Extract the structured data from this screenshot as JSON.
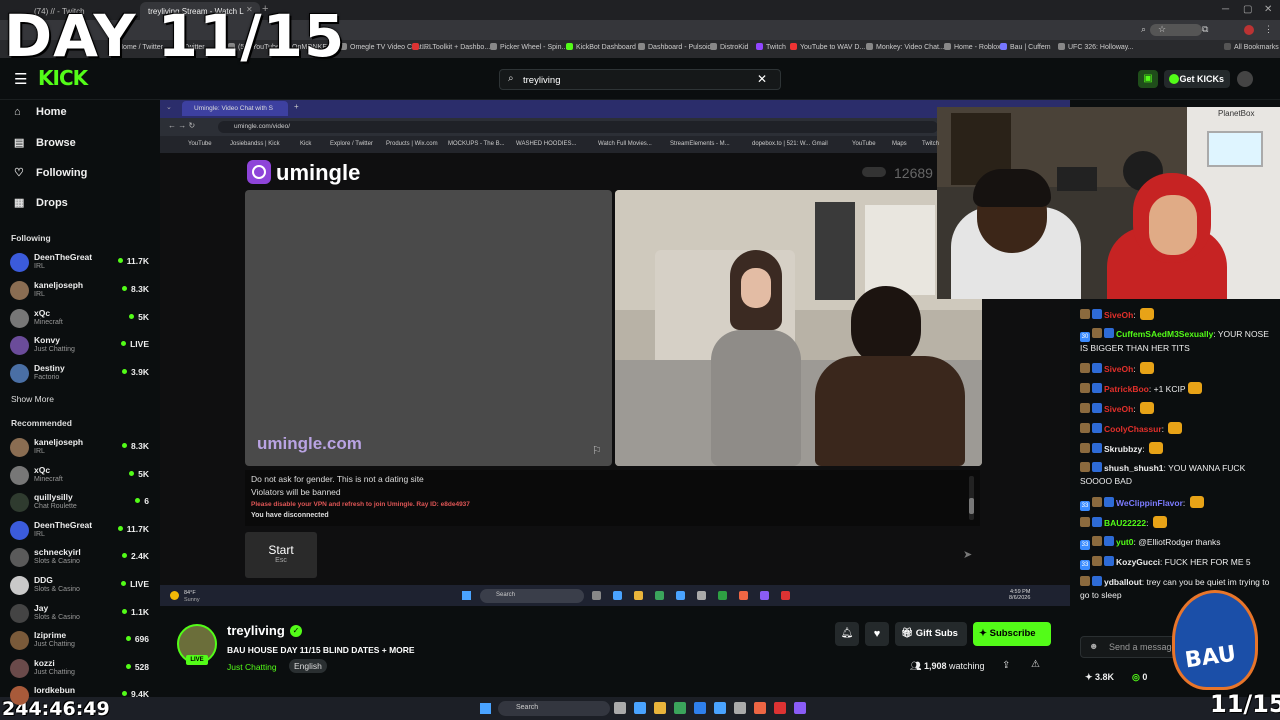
{
  "overlay": {
    "day": "DAY 11/15",
    "clock": "244:46:49",
    "day_corner": "11/15"
  },
  "browser": {
    "tabs": [
      {
        "label": "(74) // - Twitch"
      },
      {
        "label": "treyliving Stream - Watch L"
      }
    ],
    "bookmarks": [
      "Home / Twitter",
      "Twitter",
      "(57) YouTube",
      "OnMONKEY",
      "Omegle TV Video Chat...",
      "IRLToolkit + Dashbo...",
      "Picker Wheel - Spin...",
      "KickBot Dashboard",
      "Dashboard - Pulsoid",
      "DistroKid",
      "Twitch",
      "YouTube to WAV D...",
      "Monkey: Video Chat...",
      "Home - Roblox",
      "Bau | Cuffem",
      "UFC 326: Holloway..."
    ],
    "all_bookmarks": "All Bookmarks"
  },
  "kick": {
    "logo": "KICK",
    "search_value": "treyliving",
    "get_kicks": "Get KICKs",
    "nav": [
      {
        "label": "Home",
        "icon": "home-icon"
      },
      {
        "label": "Browse",
        "icon": "browse-icon"
      },
      {
        "label": "Following",
        "icon": "heart-icon"
      },
      {
        "label": "Drops",
        "icon": "drops-icon"
      }
    ],
    "following_title": "Following",
    "following": [
      {
        "name": "DeenTheGreat",
        "cat": "IRL",
        "viewers": "11.7K",
        "color": "#3b5bdb"
      },
      {
        "name": "kaneljoseph",
        "cat": "IRL",
        "viewers": "8.3K",
        "color": "#8a6d52"
      },
      {
        "name": "xQc",
        "cat": "Minecraft",
        "viewers": "5K",
        "color": "#777"
      },
      {
        "name": "Konvy",
        "cat": "Just Chatting",
        "viewers": "LIVE",
        "color": "#6b4c9a"
      },
      {
        "name": "Destiny",
        "cat": "Factorio",
        "viewers": "3.9K",
        "color": "#4a6fa5"
      }
    ],
    "show_more": "Show More",
    "recommended_title": "Recommended",
    "recommended": [
      {
        "name": "kaneljoseph",
        "cat": "IRL",
        "viewers": "8.3K",
        "color": "#8a6d52"
      },
      {
        "name": "xQc",
        "cat": "Minecraft",
        "viewers": "5K",
        "color": "#777"
      },
      {
        "name": "quillysilly",
        "cat": "Chat Roulette",
        "viewers": "6",
        "color": "#2f3b2f"
      },
      {
        "name": "DeenTheGreat",
        "cat": "IRL",
        "viewers": "11.7K",
        "color": "#3b5bdb"
      },
      {
        "name": "schneckyirl",
        "cat": "Slots & Casino",
        "viewers": "2.4K",
        "color": "#5a5a5a"
      },
      {
        "name": "DDG",
        "cat": "Slots & Casino",
        "viewers": "LIVE",
        "color": "#c9c9c9"
      },
      {
        "name": "Jay",
        "cat": "Slots & Casino",
        "viewers": "1.1K",
        "color": "#444"
      },
      {
        "name": "Iziprime",
        "cat": "Just Chatting",
        "viewers": "696",
        "color": "#7a5a3a"
      },
      {
        "name": "kozzi",
        "cat": "Just Chatting",
        "viewers": "528",
        "color": "#6a4a4a"
      },
      {
        "name": "lordkebun",
        "cat": "",
        "viewers": "9.4K",
        "color": "#a85a3a"
      }
    ],
    "channel": {
      "name": "treyliving",
      "title": "BAU HOUSE DAY 11/15 BLIND DATES + MORE",
      "category": "Just Chatting",
      "tag": "English",
      "watching_count": "1,908",
      "watching_label": "watching",
      "live": "LIVE",
      "gift": "Gift Subs",
      "subscribe": "Subscribe"
    },
    "chat": {
      "messages": [
        {
          "user": "SiveOh",
          "ucolor": "#e2302b",
          "text": ""
        },
        {
          "user": "CuffemSAedM3Sexually",
          "ucolor": "#53fc18",
          "text": "YOUR NOSE IS BIGGER THAN HER TITS",
          "badge": "30"
        },
        {
          "user": "SiveOh",
          "ucolor": "#e2302b",
          "text": ""
        },
        {
          "user": "PatrickBoo",
          "ucolor": "#e2302b",
          "text": "+1 KCIP"
        },
        {
          "user": "SiveOh",
          "ucolor": "#e2302b",
          "text": ""
        },
        {
          "user": "CoolyChassur",
          "ucolor": "#e2302b",
          "text": ""
        },
        {
          "user": "Skrubbzy",
          "ucolor": "#eee",
          "text": ""
        },
        {
          "user": "shush_shush1",
          "ucolor": "#eee",
          "text": "YOU WANNA FUCK SOOOO BAD"
        },
        {
          "user": "WeClippinFlavor",
          "ucolor": "#7b7bff",
          "text": "",
          "badge": "33"
        },
        {
          "user": "BAU22222",
          "ucolor": "#53fc18",
          "text": ""
        },
        {
          "user": "yut0",
          "ucolor": "#53fc18",
          "text": "@ElliotRodger thanks",
          "badge": "33"
        },
        {
          "user": "KozyGucci",
          "ucolor": "#eee",
          "text": "FUCK HER FOR ME 5",
          "badge": "33"
        },
        {
          "user": "ydballout",
          "ucolor": "#eee",
          "text": "trey can you be quiet im trying to go to sleep"
        }
      ],
      "input_placeholder": "Send a message",
      "kicks": "3.8K",
      "zero": "0"
    }
  },
  "inner": {
    "tab_label": "Umingle: Video Chat with S",
    "url": "umingle.com/video/",
    "bookmarks": [
      "YouTube",
      "Josiebandss | Kick",
      "Kick",
      "Explore / Twitter",
      "Products | Wix.com",
      "MOCKUPS - The B...",
      "WASHED HOODIES...",
      "Watch Full Movies...",
      "StreamElements - M...",
      "dopebox.to | 521: W...",
      "Gmail",
      "YouTube",
      "Maps",
      "Twitch"
    ],
    "brand": "umingle",
    "count": "12689",
    "watermark": "umingle.com",
    "rule1": "Do not ask for gender. This is not a dating site",
    "rule2": "Violators will be banned",
    "warn": "Please disable your VPN and refresh to join Umingle. Ray ID: e8de4937",
    "disc": "You have disconnected",
    "start": "Start",
    "esc": "Esc",
    "weather_temp": "84°F",
    "weather": "Sunny",
    "search": "Search",
    "time": "4:59 PM",
    "date": "8/6/2026"
  },
  "os_taskbar": {
    "search": "Search"
  },
  "cam_label": "PlanetBox"
}
